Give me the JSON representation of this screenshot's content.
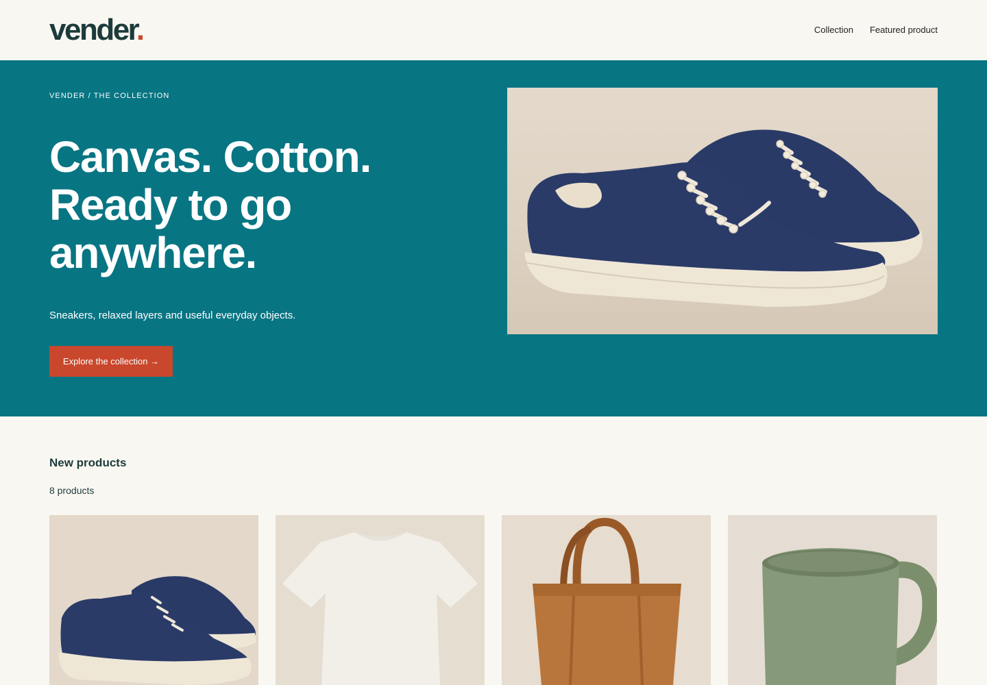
{
  "header": {
    "logo_text": "vender",
    "logo_dot": ".",
    "nav": [
      {
        "label": "Collection"
      },
      {
        "label": "Featured product"
      }
    ]
  },
  "hero": {
    "eyebrow": "VENDER / THE COLLECTION",
    "title_lines": [
      "Canvas. Cotton.",
      "Ready to go",
      "anywhere."
    ],
    "subtitle": "Sneakers, relaxed layers and useful everyday objects.",
    "cta_label": "Explore the collection →",
    "image": "navy-canvas-sneakers-photo"
  },
  "products": {
    "section_title": "New products",
    "count_label": "8 products",
    "items": [
      {
        "image": "navy-sneakers-photo"
      },
      {
        "image": "white-tshirt-photo"
      },
      {
        "image": "brown-tote-bag-photo"
      },
      {
        "image": "green-ceramic-mug-photo"
      }
    ]
  },
  "colors": {
    "hero_bg": "#087583",
    "accent": "#c9472c",
    "page_bg": "#f9f7f2",
    "logo": "#1c3b3b"
  }
}
